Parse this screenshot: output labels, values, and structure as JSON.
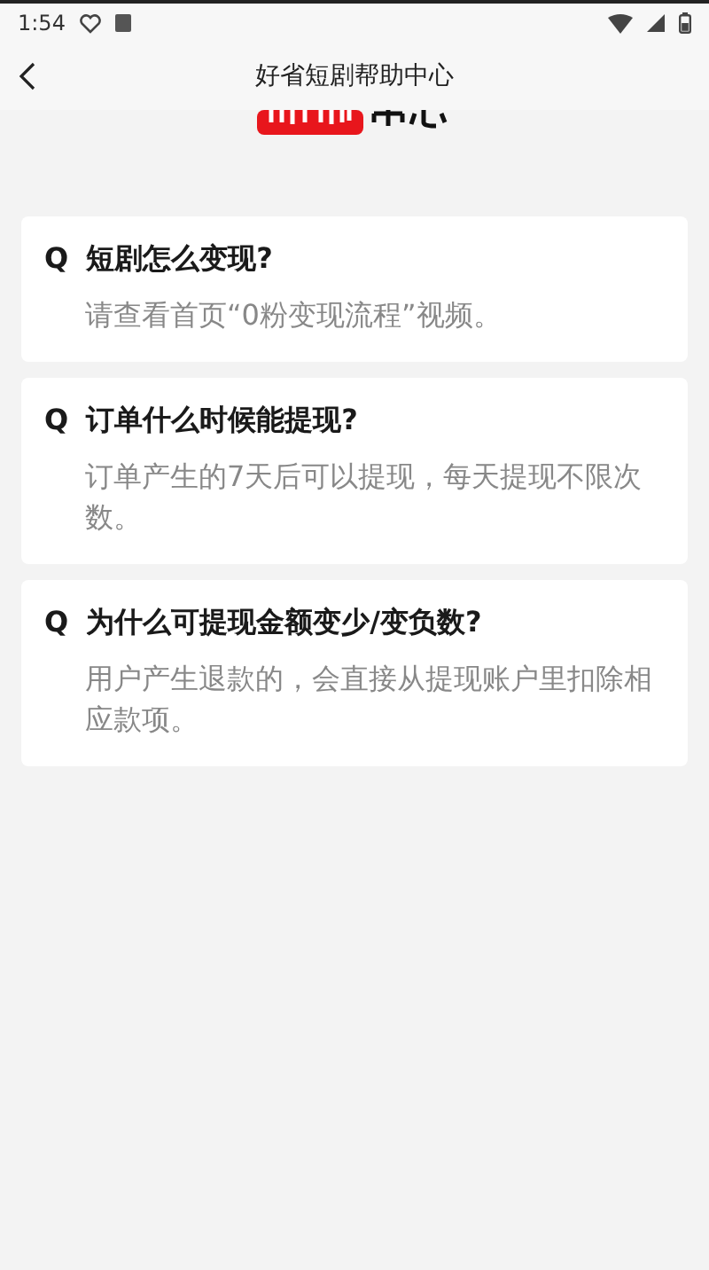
{
  "status_bar": {
    "time": "1:54"
  },
  "app_bar": {
    "title": "好省短剧帮助中心"
  },
  "faq": [
    {
      "marker": "Q",
      "question": "短剧怎么变现?",
      "answer": "请查看首页“0粉变现流程”视频。"
    },
    {
      "marker": "Q",
      "question": "订单什么时候能提现?",
      "answer": "订单产生的7天后可以提现，每天提现不限次数。"
    },
    {
      "marker": "Q",
      "question": "为什么可提现金额变少/变负数?",
      "answer": "用户产生退款的，会直接从提现账户里扣除相应款项。"
    }
  ]
}
